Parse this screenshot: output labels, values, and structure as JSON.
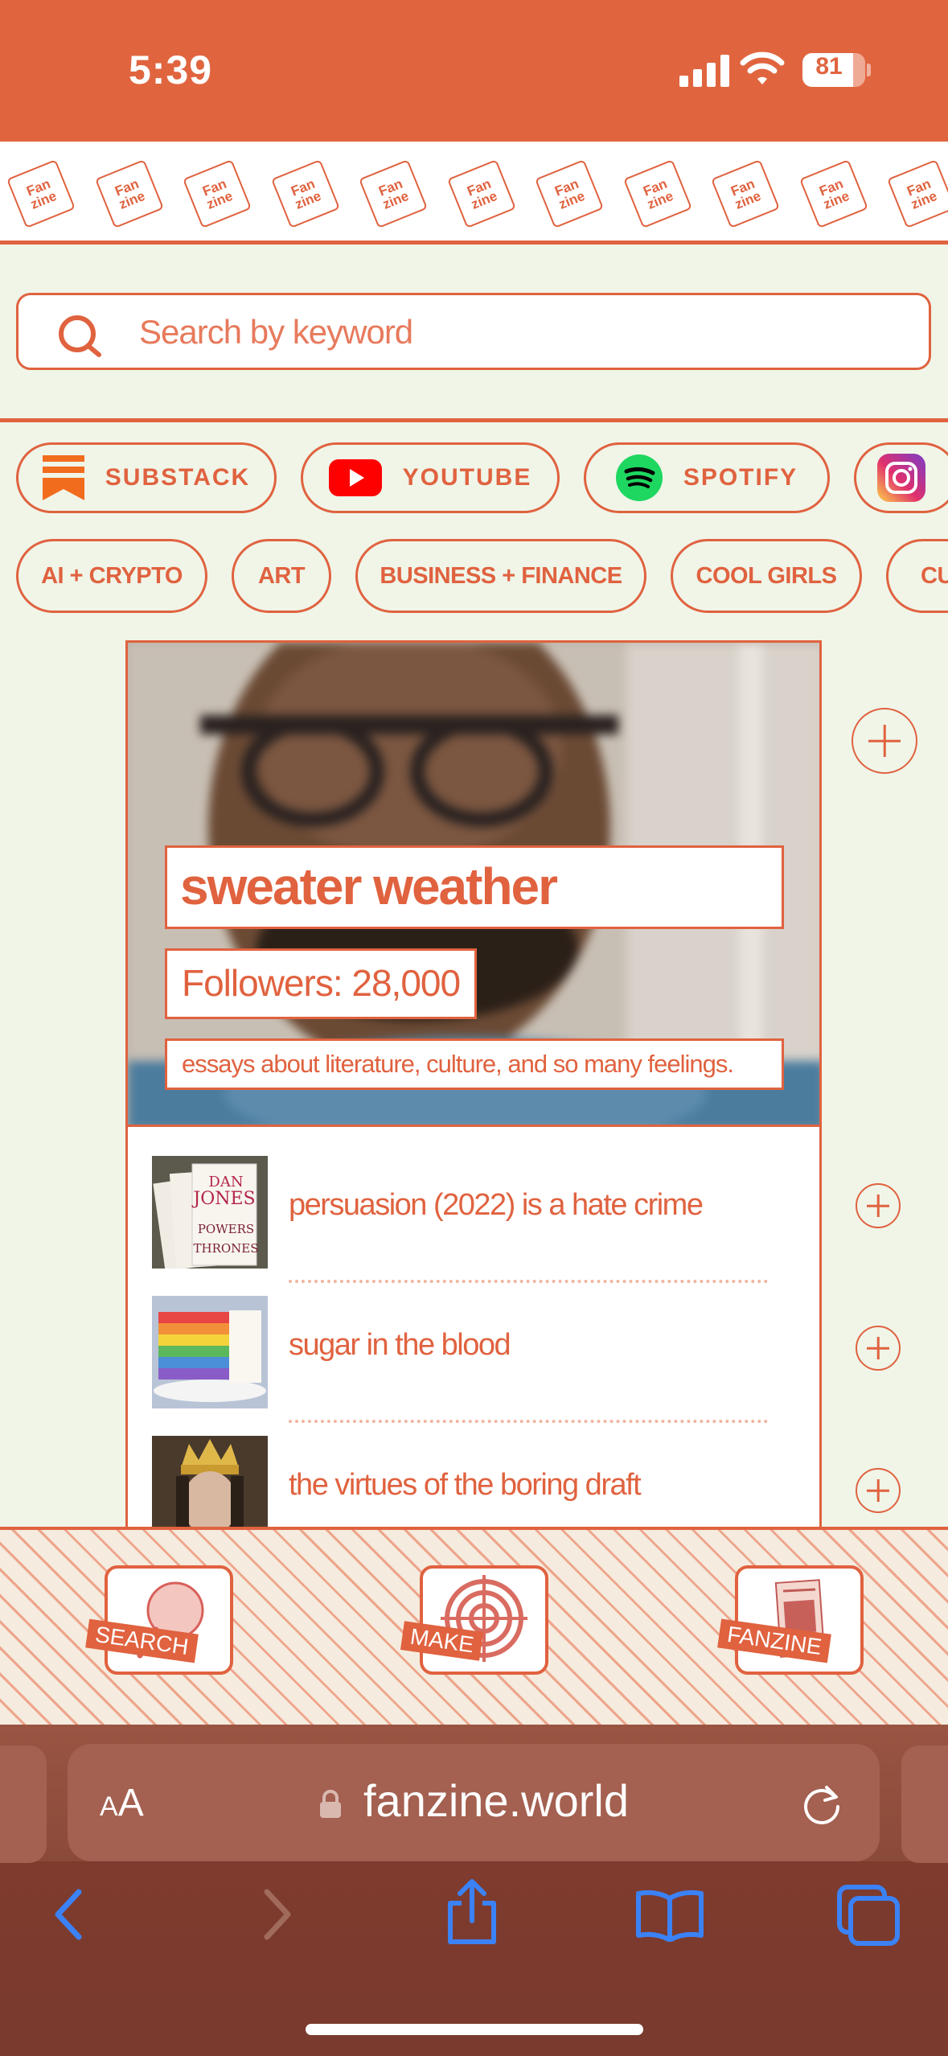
{
  "status_bar": {
    "time": "5:39",
    "battery_percent": 81,
    "battery_label": "81"
  },
  "logo": {
    "tile_text_line1": "Fan",
    "tile_text_line2": "zine"
  },
  "search": {
    "placeholder": "Search by keyword"
  },
  "platforms": [
    {
      "label": "SUBSTACK",
      "icon": "substack-icon"
    },
    {
      "label": "YOUTUBE",
      "icon": "youtube-icon"
    },
    {
      "label": "SPOTIFY",
      "icon": "spotify-icon"
    },
    {
      "label": "",
      "icon": "instagram-icon"
    }
  ],
  "categories": [
    "AI + CRYPTO",
    "ART",
    "BUSINESS + FINANCE",
    "COOL GIRLS",
    "CU"
  ],
  "featured": {
    "title": "sweater weather",
    "followers": "Followers: 28,000",
    "description": "essays about literature, culture, and so many feelings."
  },
  "posts": [
    {
      "title": "persuasion (2022) is a hate crime",
      "thumb_text": [
        "DAN",
        "JONES",
        "POWERS",
        "THRONES"
      ]
    },
    {
      "title": "sugar in the blood"
    },
    {
      "title": "the virtues of the boring draft"
    }
  ],
  "app_nav": [
    {
      "label": "SEARCH",
      "icon": "magnifier-icon"
    },
    {
      "label": "MAKE",
      "icon": "target-icon"
    },
    {
      "label": "FANZINE",
      "icon": "zine-cover-icon"
    }
  ],
  "browser": {
    "aa_small": "A",
    "aa_large": "A",
    "url": "fanzine.world"
  },
  "colors": {
    "accent": "#e0623f",
    "background": "#f0f5e8",
    "safari_bar": "#8a4a3a",
    "toolbar_icon": "#3b82f6"
  }
}
